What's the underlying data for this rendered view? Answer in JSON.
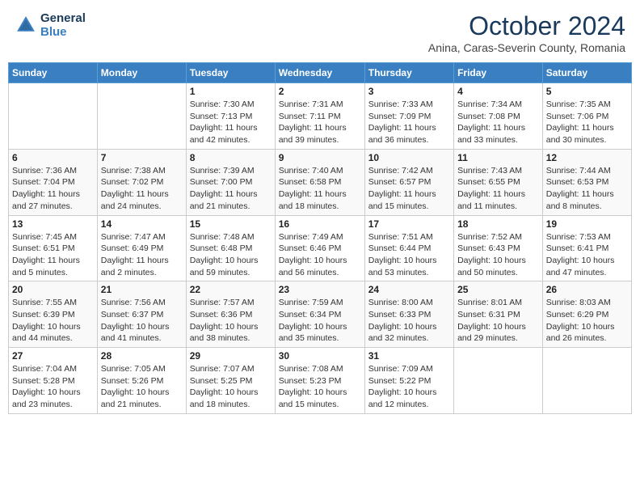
{
  "header": {
    "logo": {
      "line1": "General",
      "line2": "Blue"
    },
    "title": "October 2024",
    "subtitle": "Anina, Caras-Severin County, Romania"
  },
  "weekdays": [
    "Sunday",
    "Monday",
    "Tuesday",
    "Wednesday",
    "Thursday",
    "Friday",
    "Saturday"
  ],
  "weeks": [
    [
      {
        "day": "",
        "sunrise": "",
        "sunset": "",
        "daylight": ""
      },
      {
        "day": "",
        "sunrise": "",
        "sunset": "",
        "daylight": ""
      },
      {
        "day": "1",
        "sunrise": "Sunrise: 7:30 AM",
        "sunset": "Sunset: 7:13 PM",
        "daylight": "Daylight: 11 hours and 42 minutes."
      },
      {
        "day": "2",
        "sunrise": "Sunrise: 7:31 AM",
        "sunset": "Sunset: 7:11 PM",
        "daylight": "Daylight: 11 hours and 39 minutes."
      },
      {
        "day": "3",
        "sunrise": "Sunrise: 7:33 AM",
        "sunset": "Sunset: 7:09 PM",
        "daylight": "Daylight: 11 hours and 36 minutes."
      },
      {
        "day": "4",
        "sunrise": "Sunrise: 7:34 AM",
        "sunset": "Sunset: 7:08 PM",
        "daylight": "Daylight: 11 hours and 33 minutes."
      },
      {
        "day": "5",
        "sunrise": "Sunrise: 7:35 AM",
        "sunset": "Sunset: 7:06 PM",
        "daylight": "Daylight: 11 hours and 30 minutes."
      }
    ],
    [
      {
        "day": "6",
        "sunrise": "Sunrise: 7:36 AM",
        "sunset": "Sunset: 7:04 PM",
        "daylight": "Daylight: 11 hours and 27 minutes."
      },
      {
        "day": "7",
        "sunrise": "Sunrise: 7:38 AM",
        "sunset": "Sunset: 7:02 PM",
        "daylight": "Daylight: 11 hours and 24 minutes."
      },
      {
        "day": "8",
        "sunrise": "Sunrise: 7:39 AM",
        "sunset": "Sunset: 7:00 PM",
        "daylight": "Daylight: 11 hours and 21 minutes."
      },
      {
        "day": "9",
        "sunrise": "Sunrise: 7:40 AM",
        "sunset": "Sunset: 6:58 PM",
        "daylight": "Daylight: 11 hours and 18 minutes."
      },
      {
        "day": "10",
        "sunrise": "Sunrise: 7:42 AM",
        "sunset": "Sunset: 6:57 PM",
        "daylight": "Daylight: 11 hours and 15 minutes."
      },
      {
        "day": "11",
        "sunrise": "Sunrise: 7:43 AM",
        "sunset": "Sunset: 6:55 PM",
        "daylight": "Daylight: 11 hours and 11 minutes."
      },
      {
        "day": "12",
        "sunrise": "Sunrise: 7:44 AM",
        "sunset": "Sunset: 6:53 PM",
        "daylight": "Daylight: 11 hours and 8 minutes."
      }
    ],
    [
      {
        "day": "13",
        "sunrise": "Sunrise: 7:45 AM",
        "sunset": "Sunset: 6:51 PM",
        "daylight": "Daylight: 11 hours and 5 minutes."
      },
      {
        "day": "14",
        "sunrise": "Sunrise: 7:47 AM",
        "sunset": "Sunset: 6:49 PM",
        "daylight": "Daylight: 11 hours and 2 minutes."
      },
      {
        "day": "15",
        "sunrise": "Sunrise: 7:48 AM",
        "sunset": "Sunset: 6:48 PM",
        "daylight": "Daylight: 10 hours and 59 minutes."
      },
      {
        "day": "16",
        "sunrise": "Sunrise: 7:49 AM",
        "sunset": "Sunset: 6:46 PM",
        "daylight": "Daylight: 10 hours and 56 minutes."
      },
      {
        "day": "17",
        "sunrise": "Sunrise: 7:51 AM",
        "sunset": "Sunset: 6:44 PM",
        "daylight": "Daylight: 10 hours and 53 minutes."
      },
      {
        "day": "18",
        "sunrise": "Sunrise: 7:52 AM",
        "sunset": "Sunset: 6:43 PM",
        "daylight": "Daylight: 10 hours and 50 minutes."
      },
      {
        "day": "19",
        "sunrise": "Sunrise: 7:53 AM",
        "sunset": "Sunset: 6:41 PM",
        "daylight": "Daylight: 10 hours and 47 minutes."
      }
    ],
    [
      {
        "day": "20",
        "sunrise": "Sunrise: 7:55 AM",
        "sunset": "Sunset: 6:39 PM",
        "daylight": "Daylight: 10 hours and 44 minutes."
      },
      {
        "day": "21",
        "sunrise": "Sunrise: 7:56 AM",
        "sunset": "Sunset: 6:37 PM",
        "daylight": "Daylight: 10 hours and 41 minutes."
      },
      {
        "day": "22",
        "sunrise": "Sunrise: 7:57 AM",
        "sunset": "Sunset: 6:36 PM",
        "daylight": "Daylight: 10 hours and 38 minutes."
      },
      {
        "day": "23",
        "sunrise": "Sunrise: 7:59 AM",
        "sunset": "Sunset: 6:34 PM",
        "daylight": "Daylight: 10 hours and 35 minutes."
      },
      {
        "day": "24",
        "sunrise": "Sunrise: 8:00 AM",
        "sunset": "Sunset: 6:33 PM",
        "daylight": "Daylight: 10 hours and 32 minutes."
      },
      {
        "day": "25",
        "sunrise": "Sunrise: 8:01 AM",
        "sunset": "Sunset: 6:31 PM",
        "daylight": "Daylight: 10 hours and 29 minutes."
      },
      {
        "day": "26",
        "sunrise": "Sunrise: 8:03 AM",
        "sunset": "Sunset: 6:29 PM",
        "daylight": "Daylight: 10 hours and 26 minutes."
      }
    ],
    [
      {
        "day": "27",
        "sunrise": "Sunrise: 7:04 AM",
        "sunset": "Sunset: 5:28 PM",
        "daylight": "Daylight: 10 hours and 23 minutes."
      },
      {
        "day": "28",
        "sunrise": "Sunrise: 7:05 AM",
        "sunset": "Sunset: 5:26 PM",
        "daylight": "Daylight: 10 hours and 21 minutes."
      },
      {
        "day": "29",
        "sunrise": "Sunrise: 7:07 AM",
        "sunset": "Sunset: 5:25 PM",
        "daylight": "Daylight: 10 hours and 18 minutes."
      },
      {
        "day": "30",
        "sunrise": "Sunrise: 7:08 AM",
        "sunset": "Sunset: 5:23 PM",
        "daylight": "Daylight: 10 hours and 15 minutes."
      },
      {
        "day": "31",
        "sunrise": "Sunrise: 7:09 AM",
        "sunset": "Sunset: 5:22 PM",
        "daylight": "Daylight: 10 hours and 12 minutes."
      },
      {
        "day": "",
        "sunrise": "",
        "sunset": "",
        "daylight": ""
      },
      {
        "day": "",
        "sunrise": "",
        "sunset": "",
        "daylight": ""
      }
    ]
  ]
}
